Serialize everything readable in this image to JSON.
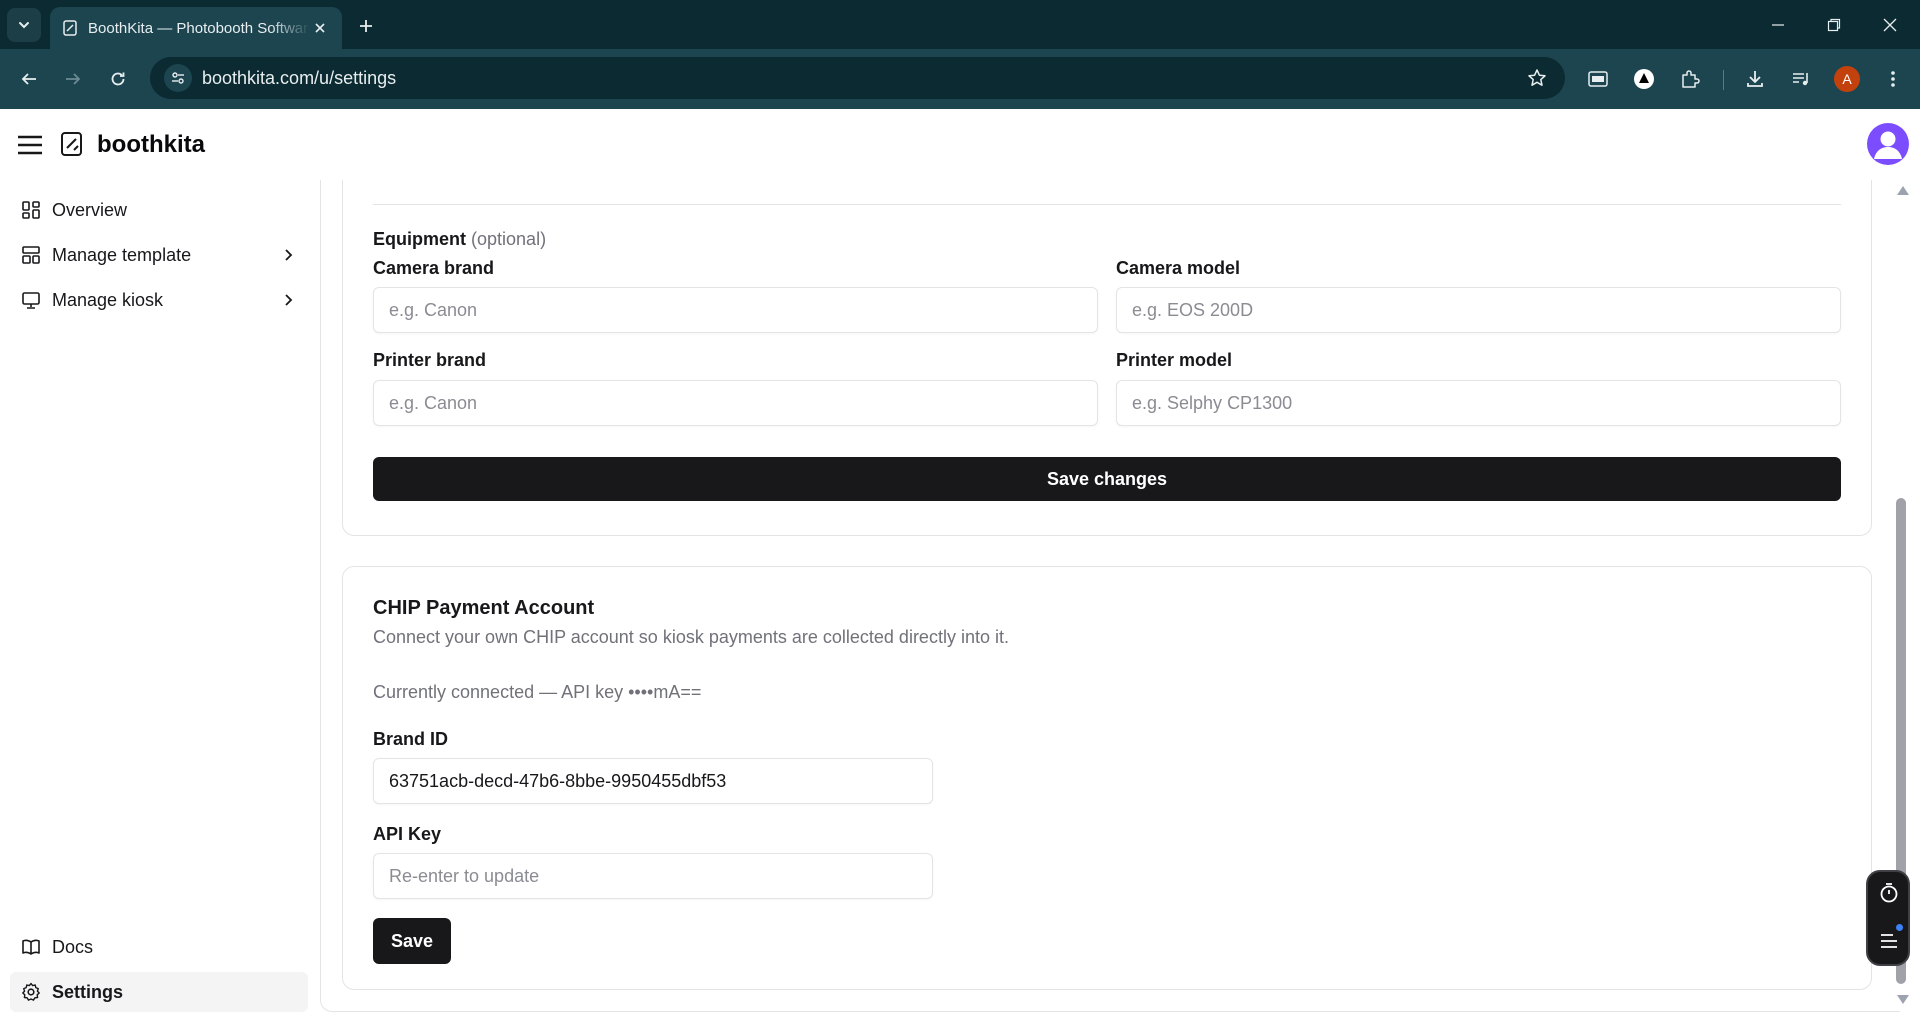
{
  "browser": {
    "tab_title": "BoothKita — Photobooth Software",
    "url": "boothkita.com/u/settings",
    "profile_initial": "A"
  },
  "app": {
    "brand": "boothkita"
  },
  "sidebar": {
    "items": [
      {
        "label": "Overview",
        "icon": "grid-icon"
      },
      {
        "label": "Manage template",
        "icon": "layout-icon"
      },
      {
        "label": "Manage kiosk",
        "icon": "monitor-icon"
      }
    ],
    "bottom": [
      {
        "label": "Docs",
        "icon": "book-icon"
      },
      {
        "label": "Settings",
        "icon": "gear-icon"
      }
    ]
  },
  "equipment": {
    "title": "Equipment",
    "optional": "(optional)",
    "camera_brand": {
      "label": "Camera brand",
      "placeholder": "e.g. Canon",
      "value": ""
    },
    "camera_model": {
      "label": "Camera model",
      "placeholder": "e.g. EOS 200D",
      "value": ""
    },
    "printer_brand": {
      "label": "Printer brand",
      "placeholder": "e.g. Canon",
      "value": ""
    },
    "printer_model": {
      "label": "Printer model",
      "placeholder": "e.g. Selphy CP1300",
      "value": ""
    },
    "save_label": "Save changes"
  },
  "chip": {
    "title": "CHIP Payment Account",
    "description": "Connect your own CHIP account so kiosk payments are collected directly into it.",
    "status": "Currently connected — API key ••••mA==",
    "brand_id": {
      "label": "Brand ID",
      "value": "63751acb-decd-47b6-8bbe-9950455dbf53"
    },
    "api_key": {
      "label": "API Key",
      "placeholder": "Re-enter to update",
      "value": ""
    },
    "save_label": "Save"
  },
  "colors": {
    "browser_frame": "#0b2a31",
    "browser_toolbar": "#1c4550",
    "primary_button": "#18181b",
    "avatar": "#7c4dff",
    "profile_badge": "#c2410c"
  }
}
